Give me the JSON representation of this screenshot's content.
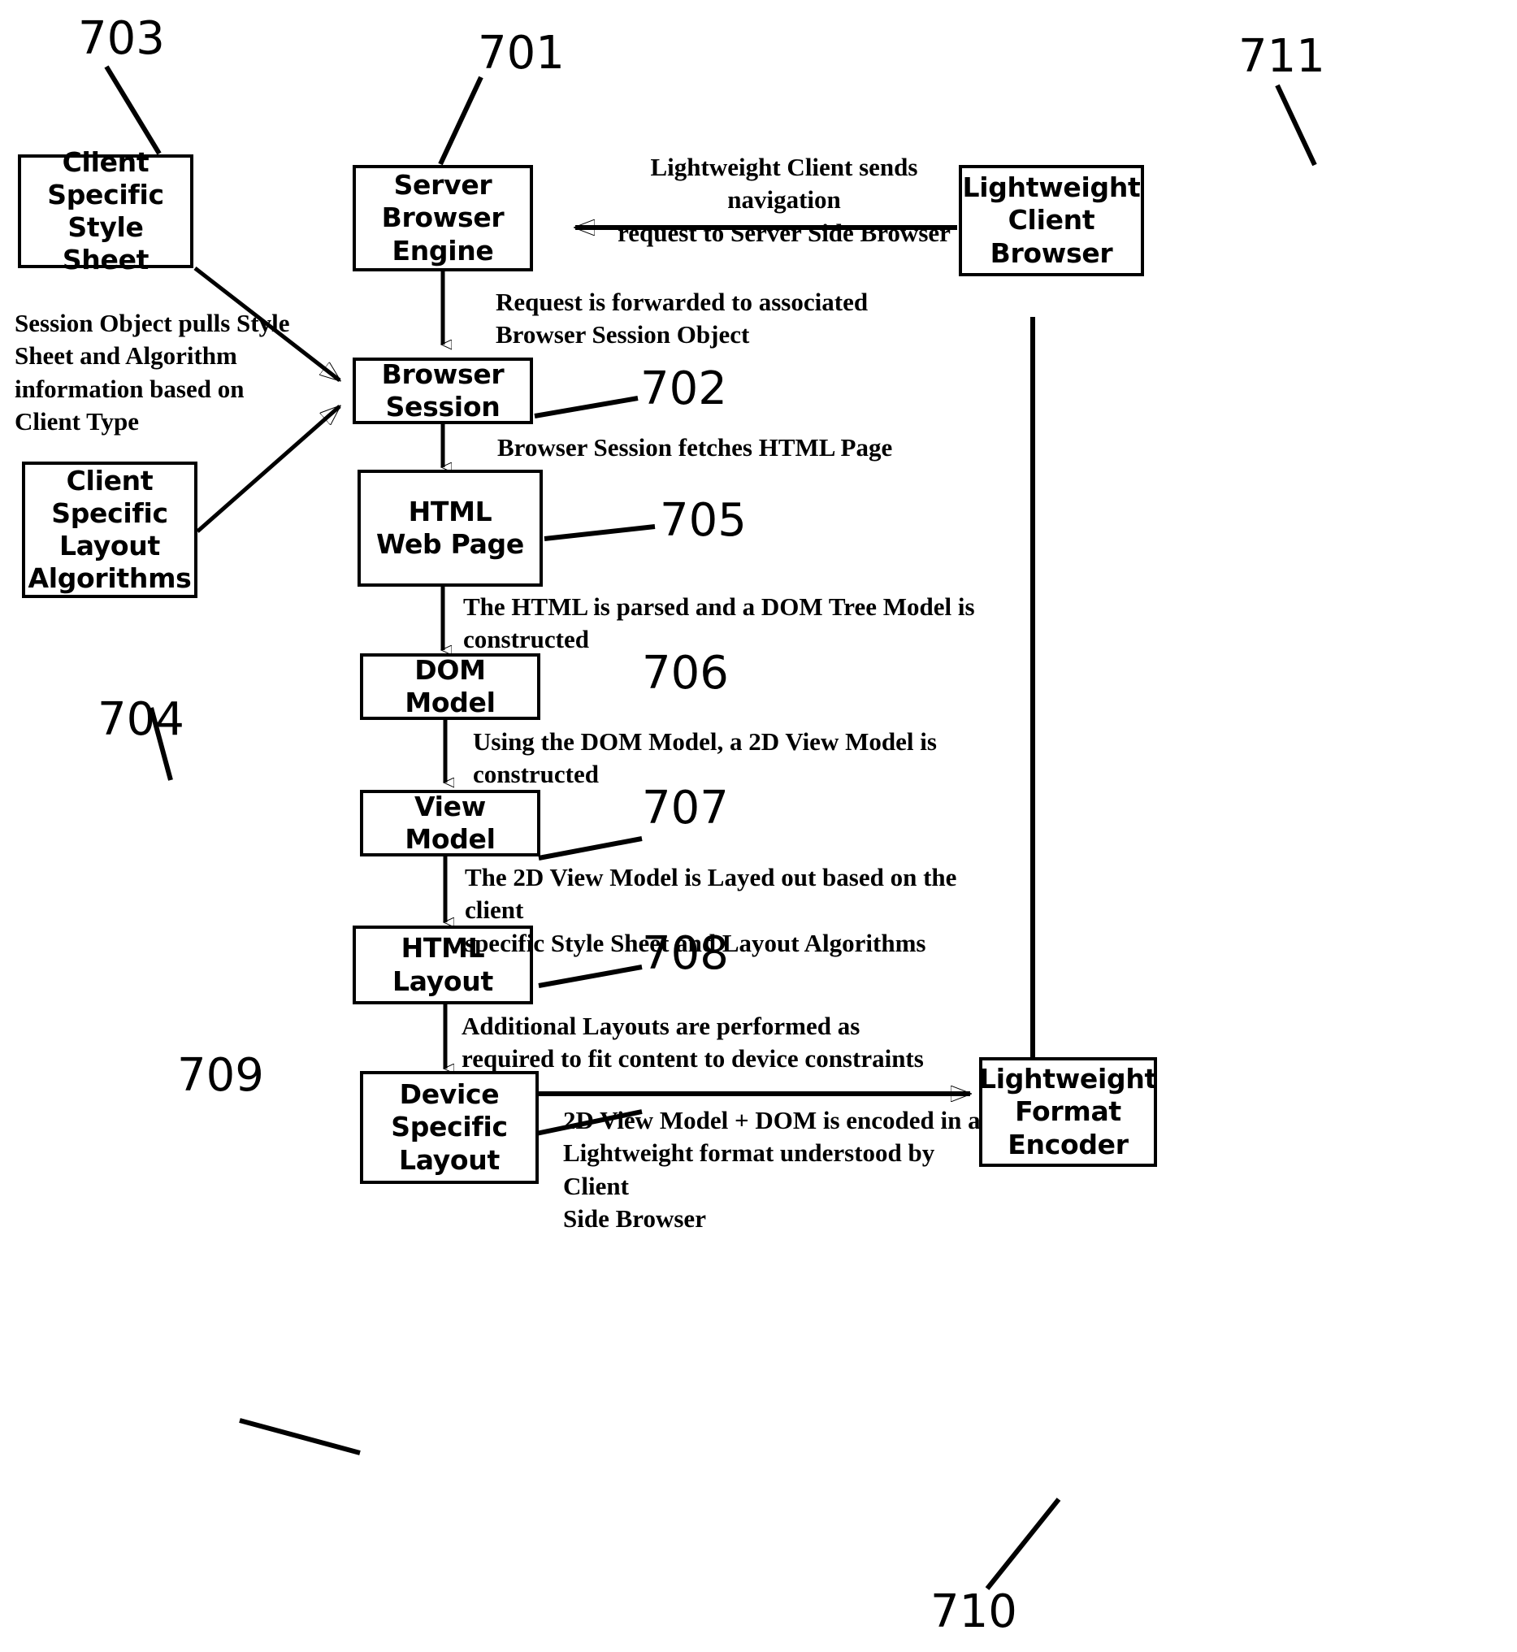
{
  "figure": {
    "type": "patent-flow-diagram",
    "background_color": "#ffffff",
    "line_color": "#000000"
  },
  "nodes": {
    "client_specific_style_sheet": "Client\nSpecific\nStyle Sheet",
    "server_browser_engine": "Server\nBrowser\nEngine",
    "lightweight_client_browser": "Lightweight\nClient\nBrowser",
    "browser_session": "Browser\nSession",
    "client_specific_layout_algorithms": "Client\nSpecific\nLayout\nAlgorithms",
    "html_web_page": "HTML\nWeb Page",
    "dom_model": "DOM Model",
    "view_model": "View Model",
    "html_layout": "HTML\nLayout",
    "device_specific_layout": "Device\nSpecific\nLayout",
    "lightweight_format_encoder": "Lightweight\nFormat\nEncoder"
  },
  "reference_numerals": {
    "ref_703": "703",
    "ref_701": "701",
    "ref_711": "711",
    "ref_702": "702",
    "ref_705": "705",
    "ref_704": "704",
    "ref_706": "706",
    "ref_707": "707",
    "ref_708": "708",
    "ref_709": "709",
    "ref_710": "710"
  },
  "annotations": {
    "client_sends_navigation": "Lightweight Client sends navigation\nrequest to Server Side Browser",
    "session_pulls_style": "Session Object pulls Style\nSheet and Algorithm\ninformation based on\nClient Type",
    "request_forwarded": "Request is forwarded to associated\nBrowser Session Object",
    "session_fetches_html": "Browser Session fetches HTML Page",
    "html_parsed_dom": "The HTML is parsed and a DOM Tree Model is constructed",
    "dom_to_view": "Using the DOM Model, a 2D View Model is\nconstructed",
    "view_layed_out": "The 2D View Model is Layed out based on the client\nspecific Style Sheet and Layout Algorithms",
    "additional_layouts": "Additional Layouts are performed as\nrequired to fit content to device constraints",
    "encoded_lightweight": "2D View Model + DOM is encoded in a\nLightweight format understood by Client\nSide Browser"
  }
}
